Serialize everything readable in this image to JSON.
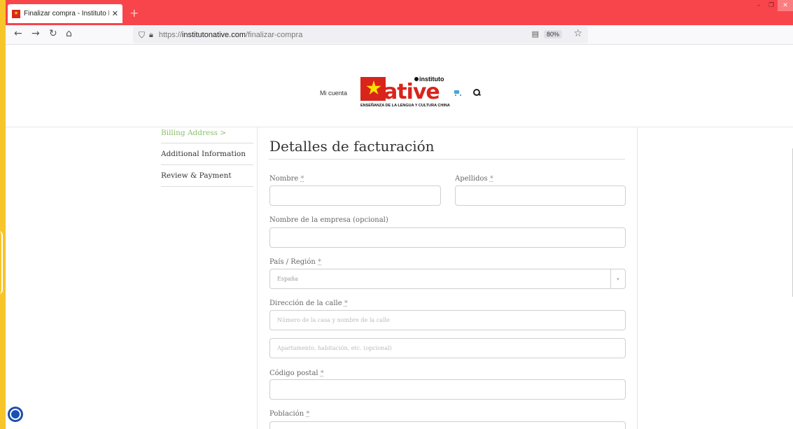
{
  "browser": {
    "tab_title": "Finalizar compra - Instituto Nati",
    "tab_close": "✕",
    "new_tab": "+",
    "url_prefix": "https://",
    "url_domain": "institutonative.com",
    "url_path": "/finalizar-compra",
    "zoom": "80%",
    "nav": {
      "back": "←",
      "forward": "→",
      "reload": "↻",
      "home": "⌂"
    },
    "window_controls": {
      "minimize": "–",
      "maximize": "❐",
      "close": "✕"
    }
  },
  "header": {
    "account_link": "Mi cuenta",
    "logo": {
      "small": "instituto",
      "word": "ative",
      "tagline": "ENSEÑANZA DE LA LENGUA Y CULTURA CHINA"
    }
  },
  "steps": [
    {
      "label": "Billing Address >",
      "active": true
    },
    {
      "label": "Additional Information",
      "active": false
    },
    {
      "label": "Review & Payment",
      "active": false
    }
  ],
  "form": {
    "title": "Detalles de facturación",
    "required_mark": "*",
    "first_name_label": "Nombre",
    "last_name_label": "Apellidos",
    "company_label": "Nombre de la empresa (opcional)",
    "country_label": "País / Región",
    "country_value": "España",
    "street_label": "Dirección de la calle",
    "street_placeholder": "Número de la casa y nombre de la calle",
    "street2_placeholder": "Apartamento, habitación, etc. (opcional)",
    "postcode_label": "Código postal",
    "city_label": "Población"
  },
  "colors": {
    "titlebar": "#f8454b",
    "step_active": "#8abf6a",
    "logo_red": "#d9241c",
    "desktop": "#f7c52a"
  }
}
